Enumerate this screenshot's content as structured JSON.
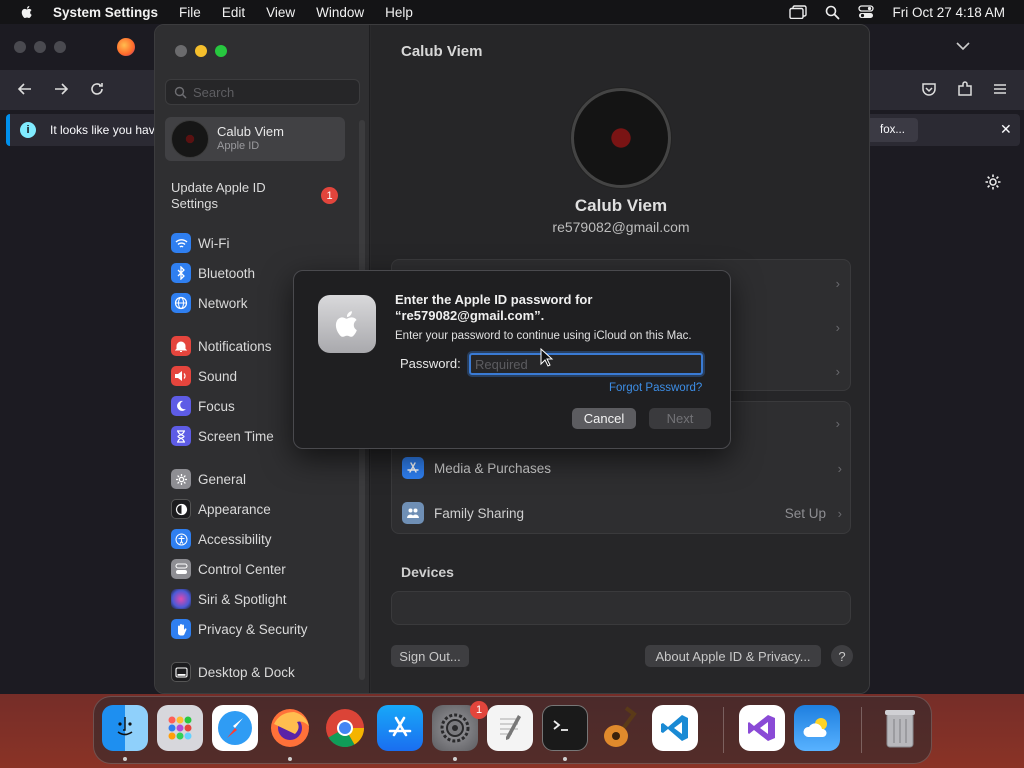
{
  "menubar": {
    "app_name": "System Settings",
    "menus": [
      "File",
      "Edit",
      "View",
      "Window",
      "Help"
    ],
    "clock": "Fri Oct 27  4:18 AM"
  },
  "firefox": {
    "notice_text": "It looks like you have",
    "notice_button": "fox..."
  },
  "sidebar": {
    "search_placeholder": "Search",
    "account_name": "Calub Viem",
    "account_sub": "Apple ID",
    "update_label": "Update Apple ID Settings",
    "update_badge": "1",
    "items": [
      {
        "label": "Wi-Fi",
        "icon": "wifi-icon",
        "color": "#2f7ff0"
      },
      {
        "label": "Bluetooth",
        "icon": "bluetooth-icon",
        "color": "#2f7ff0"
      },
      {
        "label": "Network",
        "icon": "globe-icon",
        "color": "#2f7ff0"
      },
      {
        "label": "Notifications",
        "icon": "bell-icon",
        "color": "#e5453d"
      },
      {
        "label": "Sound",
        "icon": "speaker-icon",
        "color": "#e5453d"
      },
      {
        "label": "Focus",
        "icon": "moon-icon",
        "color": "#5e5ce6"
      },
      {
        "label": "Screen Time",
        "icon": "hourglass-icon",
        "color": "#5e5ce6"
      },
      {
        "label": "General",
        "icon": "gear-icon",
        "color": "#8e8e93"
      },
      {
        "label": "Appearance",
        "icon": "appearance-icon",
        "color": "#1c1c1e"
      },
      {
        "label": "Accessibility",
        "icon": "accessibility-icon",
        "color": "#2f7ff0"
      },
      {
        "label": "Control Center",
        "icon": "control-center-icon",
        "color": "#8e8e93"
      },
      {
        "label": "Siri & Spotlight",
        "icon": "siri-icon",
        "color": "#b44ad6"
      },
      {
        "label": "Privacy & Security",
        "icon": "hand-icon",
        "color": "#2f7ff0"
      },
      {
        "label": "Desktop & Dock",
        "icon": "dock-icon",
        "color": "#1c1c1e"
      }
    ]
  },
  "content": {
    "window_title": "Calub Viem",
    "name": "Calub Viem",
    "email": "re579082@gmail.com",
    "media_label": "Media & Purchases",
    "family_label": "Family Sharing",
    "family_value": "Set Up",
    "devices_header": "Devices",
    "sign_out": "Sign Out...",
    "about": "About Apple ID & Privacy...",
    "help": "?"
  },
  "dialog": {
    "title": "Enter the Apple ID password for “re579082@gmail.com”.",
    "message": "Enter your password to continue using iCloud on this Mac.",
    "password_label": "Password:",
    "password_placeholder": "Required",
    "password_value": "",
    "forgot": "Forgot Password?",
    "cancel": "Cancel",
    "next": "Next"
  },
  "dock": {
    "settings_badge": "1",
    "apps": [
      "finder",
      "launchpad",
      "safari",
      "firefox",
      "chrome",
      "app-store",
      "system-settings",
      "textedit",
      "terminal",
      "garageband",
      "vscode",
      "visual-studio",
      "weather",
      "trash"
    ]
  }
}
